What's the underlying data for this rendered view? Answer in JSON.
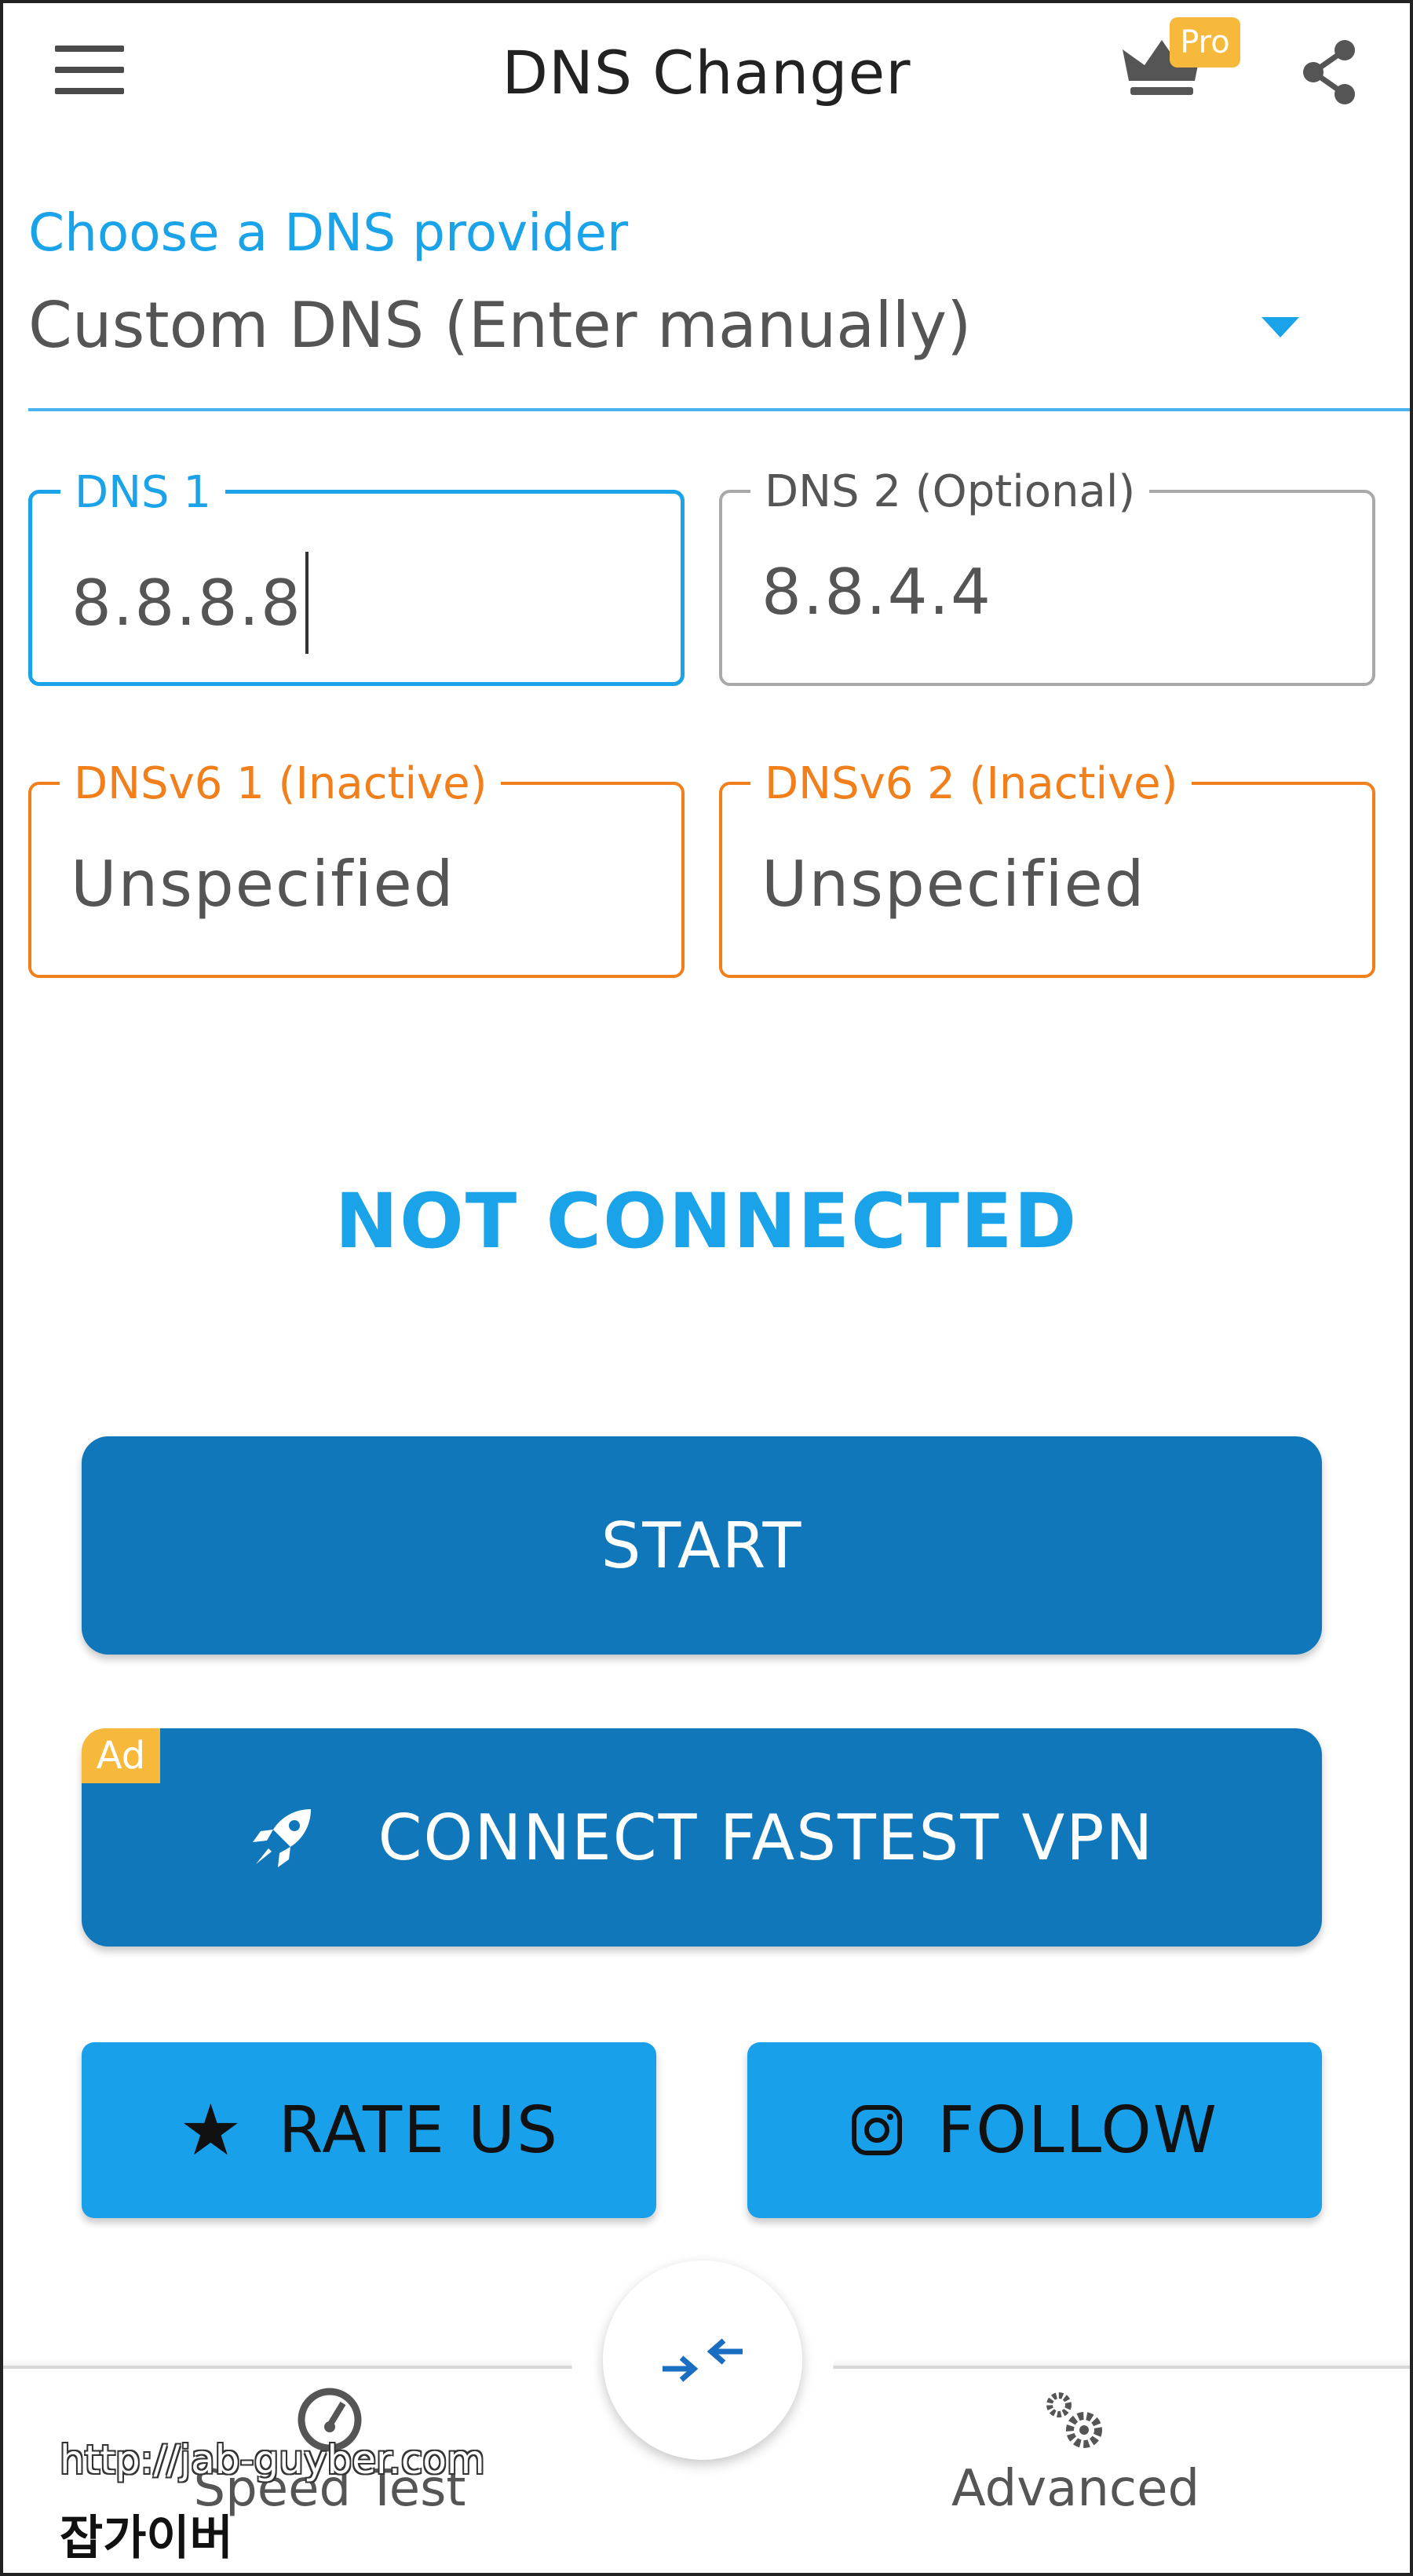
{
  "app": {
    "title": "DNS Changer",
    "pro_badge": "Pro"
  },
  "provider": {
    "label": "Choose a DNS provider",
    "selected": "Custom DNS (Enter manually)"
  },
  "fields": {
    "dns1": {
      "label": "DNS 1",
      "value": "8.8.8.8"
    },
    "dns2": {
      "label": "DNS 2 (Optional)",
      "value": "8.8.4.4"
    },
    "dnsv6_1": {
      "label": "DNSv6 1 (Inactive)",
      "value": "Unspecified"
    },
    "dnsv6_2": {
      "label": "DNSv6 2 (Inactive)",
      "value": "Unspecified"
    }
  },
  "status": "NOT CONNECTED",
  "buttons": {
    "start": "START",
    "vpn": "CONNECT FASTEST VPN",
    "ad_badge": "Ad",
    "rate": "RATE US",
    "follow": "FOLLOW"
  },
  "bottom_nav": {
    "speed_test": "Speed Test",
    "advanced": "Advanced"
  },
  "watermark": {
    "url": "http://jab-guyber.com",
    "text": "잡가이버"
  },
  "colors": {
    "accent": "#1aa3e8",
    "button_dark": "#1077bb",
    "button_light": "#18a0eb",
    "inactive": "#f07f1c",
    "badge": "#f6b93b"
  },
  "icons": [
    "menu-icon",
    "crown-icon",
    "share-icon",
    "dropdown-arrow-icon",
    "rocket-icon",
    "star-icon",
    "instagram-icon",
    "swap-arrows-icon",
    "speedometer-icon",
    "gears-icon"
  ]
}
